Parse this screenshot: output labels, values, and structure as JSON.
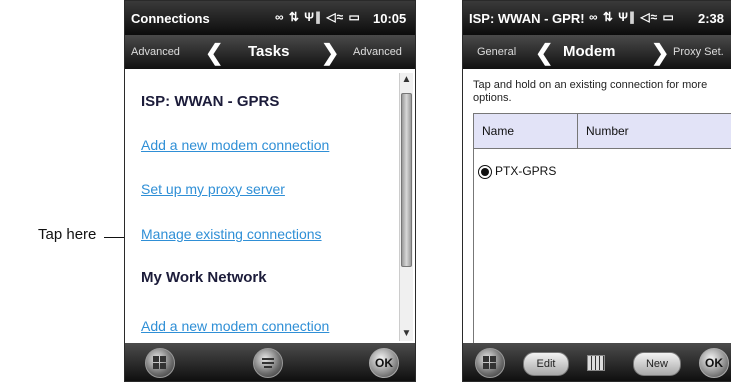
{
  "callout": {
    "text": "Tap here"
  },
  "screen1": {
    "status_title": "Connections",
    "status_icons": "∞ ⇅ Ψ∥ ◁≈ ▭",
    "time": "10:05",
    "nav_left": "Advanced",
    "nav_center": "Tasks",
    "nav_right": "Advanced",
    "sections": [
      {
        "heading": "ISP: WWAN - GPRS",
        "links": [
          "Add a new modem connection",
          "Set up my proxy server",
          "Manage existing connections"
        ]
      },
      {
        "heading": "My Work Network",
        "links": [
          "Add a new modem connection"
        ]
      }
    ],
    "softkeys": {
      "center_icon": "keyboard-icon",
      "right": "OK"
    }
  },
  "screen2": {
    "status_title": "ISP: WWAN - GPR!",
    "status_icons": "∞ ⇅ Ψ∥ ◁≈ ▭",
    "time": "2:38",
    "nav_left": "General",
    "nav_center": "Modem",
    "nav_right": "Proxy Set.",
    "hint": "Tap and hold on an existing connection for more options.",
    "columns": [
      "Name",
      "Number"
    ],
    "rows": [
      {
        "name": "PTX-GPRS",
        "number": "",
        "selected": true
      }
    ],
    "softkeys": {
      "left": "Edit",
      "right": "New",
      "ok": "OK"
    }
  }
}
